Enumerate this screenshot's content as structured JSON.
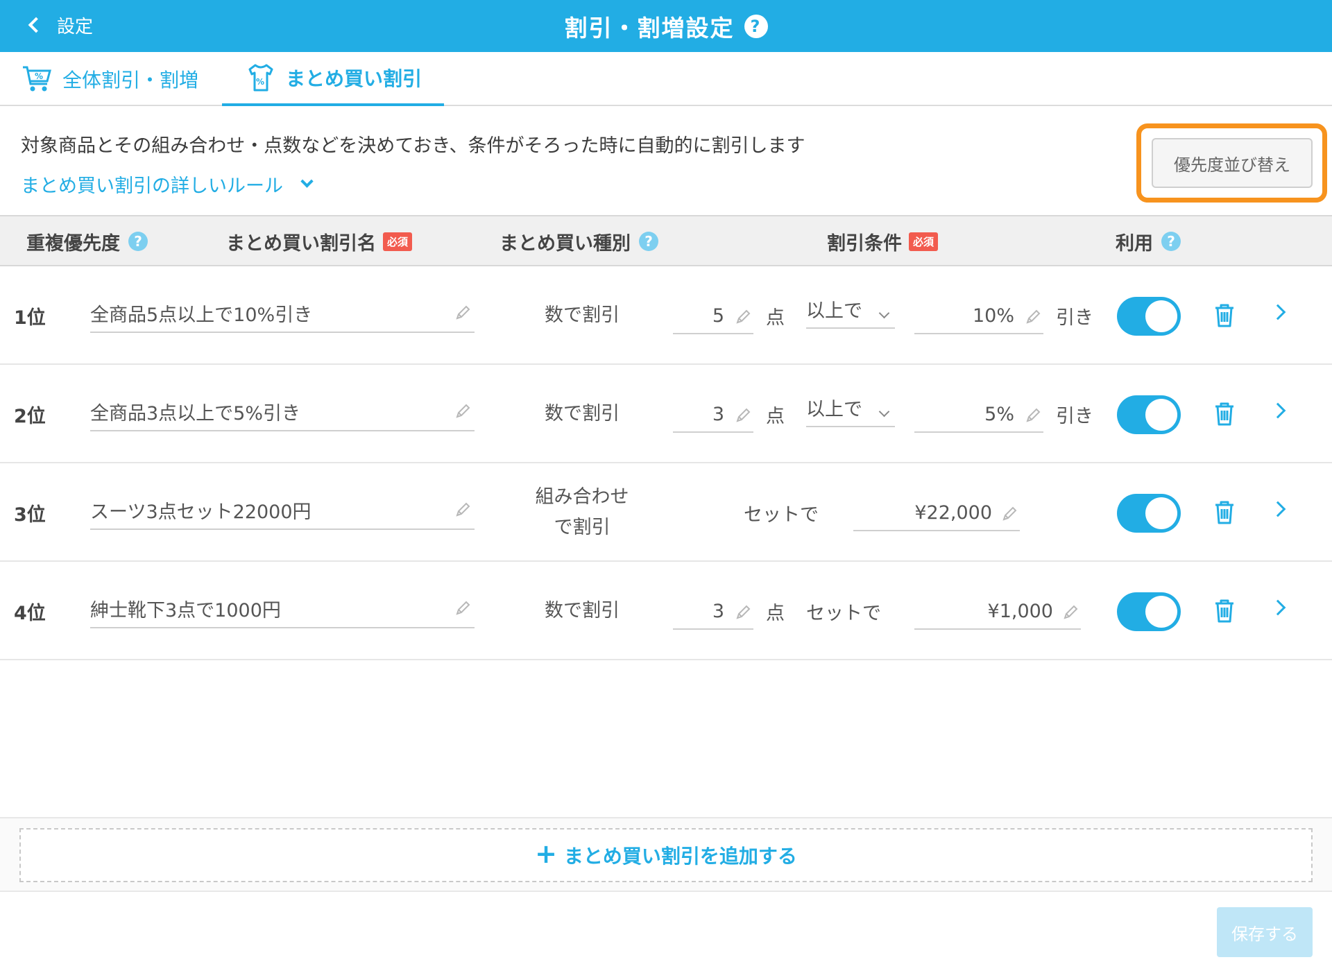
{
  "header": {
    "back_label": "設定",
    "title": "割引・割増設定"
  },
  "tabs": [
    {
      "label": "全体割引・割増"
    },
    {
      "label": "まとめ買い割引"
    }
  ],
  "description": "対象商品とその組み合わせ・点数などを決めておき、条件がそろった時に自動的に割引します",
  "rules_link": "まとめ買い割引の詳しいルール",
  "sort_button": "優先度並び替え",
  "table": {
    "headers": {
      "priority": "重複優先度",
      "name": "まとめ買い割引名",
      "type": "まとめ買い種別",
      "condition": "割引条件",
      "use": "利用",
      "required": "必須"
    },
    "rows": [
      {
        "rank": "1位",
        "name": "全商品5点以上で10%引き",
        "type": "数で割引",
        "qty": "5",
        "qty_unit": "点",
        "condition": "以上で",
        "value": "10%",
        "value_suffix": "引き",
        "enabled": true
      },
      {
        "rank": "2位",
        "name": "全商品3点以上で5%引き",
        "type": "数で割引",
        "qty": "3",
        "qty_unit": "点",
        "condition": "以上で",
        "value": "5%",
        "value_suffix": "引き",
        "enabled": true
      },
      {
        "rank": "3位",
        "name": "スーツ3点セット22000円",
        "type_line1": "組み合わせ",
        "type_line2": "で割引",
        "condition": "セットで",
        "value": "¥22,000",
        "enabled": true
      },
      {
        "rank": "4位",
        "name": "紳士靴下3点で1000円",
        "type": "数で割引",
        "qty": "3",
        "qty_unit": "点",
        "condition": "セットで",
        "value": "¥1,000",
        "enabled": true
      }
    ]
  },
  "add_button": "まとめ買い割引を追加する",
  "save_button": "保存する",
  "colors": {
    "accent": "#22ade4",
    "highlight": "#f7931e",
    "required_badge": "#f25b4e"
  }
}
